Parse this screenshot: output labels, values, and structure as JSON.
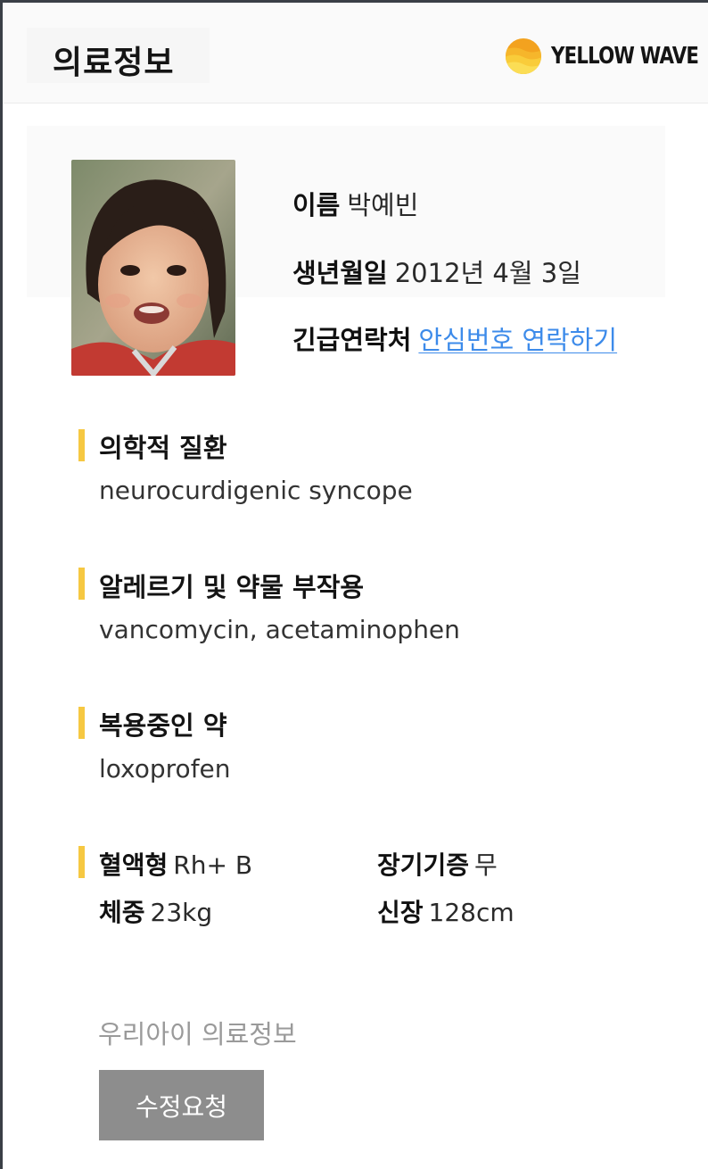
{
  "header": {
    "title": "의료정보",
    "brand_name": "YELLOW WAVE",
    "brand_icon": "yellow-wave-logo"
  },
  "profile": {
    "name_label": "이름",
    "name_value": "박예빈",
    "birth_label": "생년월일",
    "birth_value": "2012년 4월 3일",
    "contact_label": "긴급연락처",
    "contact_link": "안심번호 연락하기"
  },
  "sections": {
    "condition": {
      "title": "의학적 질환",
      "value": "neurocurdigenic syncope"
    },
    "allergy": {
      "title": "알레르기 및 약물 부작용",
      "value": "vancomycin, acetaminophen"
    },
    "medication": {
      "title": "복용중인 약",
      "value": "loxoprofen"
    }
  },
  "stats": {
    "blood_label": "혈액형",
    "blood_value": "Rh+ B",
    "donor_label": "장기기증",
    "donor_value": "무",
    "weight_label": "체중",
    "weight_value": "23kg",
    "height_label": "신장",
    "height_value": "128cm"
  },
  "footer": {
    "label": "우리아이 의료정보",
    "edit_button": "수정요청"
  },
  "colors": {
    "accent": "#f6c842",
    "link": "#3d8bea",
    "button_bg": "#8d8d8d"
  }
}
